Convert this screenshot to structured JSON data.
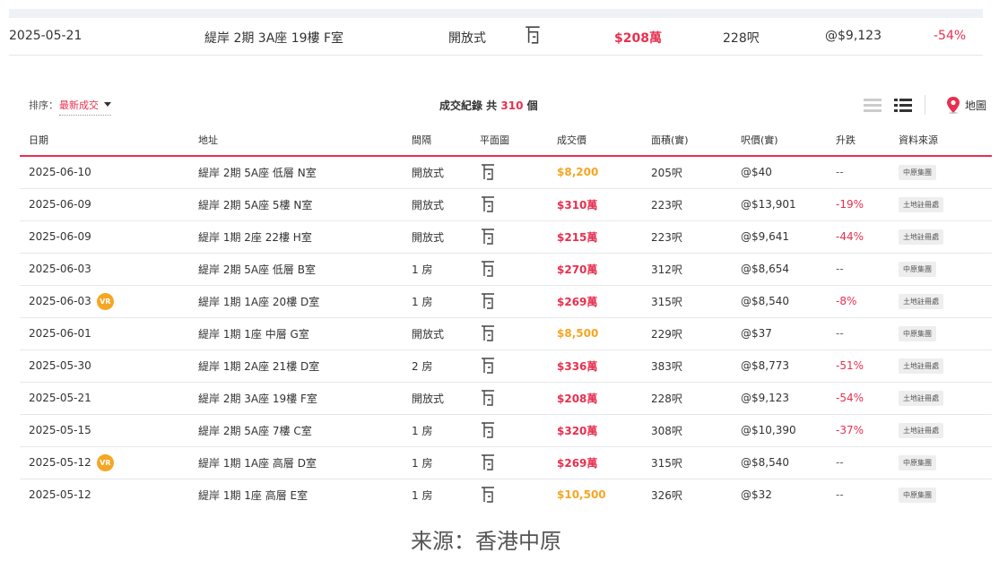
{
  "highlight": {
    "date": "2025-05-21",
    "address": "緹岸 2期 3A座 19樓 F室",
    "layout": "開放式",
    "price": "$208萬",
    "area": "228呎",
    "unit_price": "@$9,123",
    "change": "-54%"
  },
  "toolbar": {
    "sort_label": "排序：",
    "sort_value": "最新成交",
    "summary_prefix": "成交紀錄 共",
    "summary_count": "310",
    "summary_suffix": "個",
    "map_label": "地圖"
  },
  "columns": [
    "日期",
    "地址",
    "間隔",
    "平面圖",
    "成交價",
    "面積(實)",
    "呎價(實)",
    "升跌",
    "資料來源"
  ],
  "rows": [
    {
      "date": "2025-06-10",
      "vr": false,
      "address": "緹岸 2期 5A座 低層 N室",
      "layout": "開放式",
      "price": "$8,200",
      "price_type": "rent",
      "area": "205呎",
      "unit_price": "@$40",
      "change": "--",
      "source": "中原集團"
    },
    {
      "date": "2025-06-09",
      "vr": false,
      "address": "緹岸 2期 5A座 5樓 N室",
      "layout": "開放式",
      "price": "$310萬",
      "price_type": "sale",
      "area": "223呎",
      "unit_price": "@$13,901",
      "change": "-19%",
      "source": "土地註冊處"
    },
    {
      "date": "2025-06-09",
      "vr": false,
      "address": "緹岸 1期 2座 22樓 H室",
      "layout": "開放式",
      "price": "$215萬",
      "price_type": "sale",
      "area": "223呎",
      "unit_price": "@$9,641",
      "change": "-44%",
      "source": "土地註冊處"
    },
    {
      "date": "2025-06-03",
      "vr": false,
      "address": "緹岸 2期 5A座 低層 B室",
      "layout": "1 房",
      "price": "$270萬",
      "price_type": "sale",
      "area": "312呎",
      "unit_price": "@$8,654",
      "change": "--",
      "source": "中原集團"
    },
    {
      "date": "2025-06-03",
      "vr": true,
      "address": "緹岸 1期 1A座 20樓 D室",
      "layout": "1 房",
      "price": "$269萬",
      "price_type": "sale",
      "area": "315呎",
      "unit_price": "@$8,540",
      "change": "-8%",
      "source": "土地註冊處"
    },
    {
      "date": "2025-06-01",
      "vr": false,
      "address": "緹岸 1期 1座 中層 G室",
      "layout": "開放式",
      "price": "$8,500",
      "price_type": "rent",
      "area": "229呎",
      "unit_price": "@$37",
      "change": "--",
      "source": "中原集團"
    },
    {
      "date": "2025-05-30",
      "vr": false,
      "address": "緹岸 1期 2A座 21樓 D室",
      "layout": "2 房",
      "price": "$336萬",
      "price_type": "sale",
      "area": "383呎",
      "unit_price": "@$8,773",
      "change": "-51%",
      "source": "土地註冊處"
    },
    {
      "date": "2025-05-21",
      "vr": false,
      "address": "緹岸 2期 3A座 19樓 F室",
      "layout": "開放式",
      "price": "$208萬",
      "price_type": "sale",
      "area": "228呎",
      "unit_price": "@$9,123",
      "change": "-54%",
      "source": "土地註冊處"
    },
    {
      "date": "2025-05-15",
      "vr": false,
      "address": "緹岸 2期 5A座 7樓 C室",
      "layout": "1 房",
      "price": "$320萬",
      "price_type": "sale",
      "area": "308呎",
      "unit_price": "@$10,390",
      "change": "-37%",
      "source": "土地註冊處"
    },
    {
      "date": "2025-05-12",
      "vr": true,
      "address": "緹岸 1期 1A座 高層 D室",
      "layout": "1 房",
      "price": "$269萬",
      "price_type": "sale",
      "area": "315呎",
      "unit_price": "@$8,540",
      "change": "--",
      "source": "中原集團"
    },
    {
      "date": "2025-05-12",
      "vr": false,
      "address": "緹岸 1期 1座 高層 E室",
      "layout": "1 房",
      "price": "$10,500",
      "price_type": "rent",
      "area": "326呎",
      "unit_price": "@$32",
      "change": "--",
      "source": "中原集團"
    }
  ],
  "vr_label": "VR",
  "caption": "来源：香港中原",
  "icons": {
    "floor_plan": "floor-plan-icon",
    "list_view": "list-view-icon",
    "detail_list_view": "detail-list-view-icon",
    "map": "map-pin-icon",
    "sort_caret": "caret-down-icon"
  },
  "colors": {
    "accent": "#e8304f",
    "rent_price": "#f5a623",
    "vr_badge": "#f5a623"
  }
}
